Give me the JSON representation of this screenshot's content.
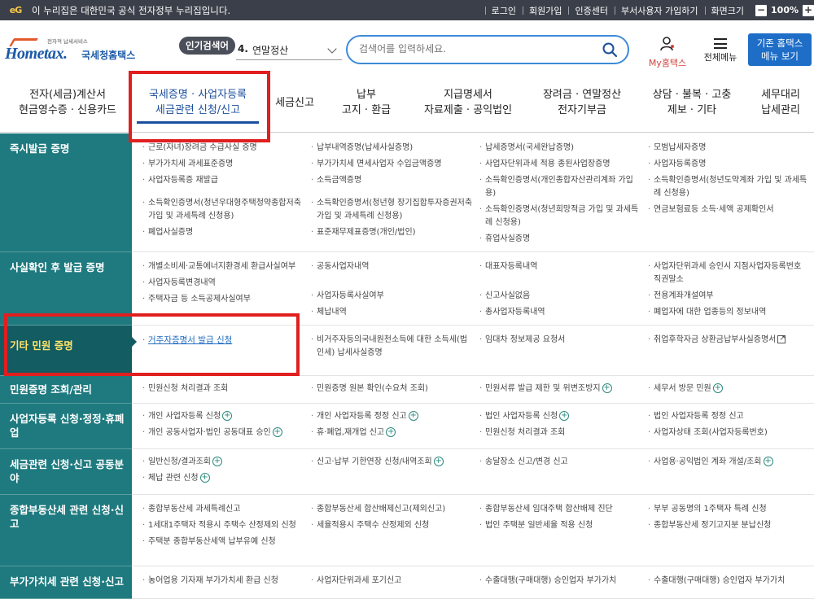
{
  "gov_bar": {
    "logo": "eG",
    "notice": "이 누리집은 대한민국 공식 전자정부 누리집입니다.",
    "links": [
      "로그인",
      "회원가입",
      "인증센터",
      "부서사용자 가입하기",
      "화면크기"
    ],
    "zoom_minus": "−",
    "zoom_value": "100%",
    "zoom_plus": "+"
  },
  "header": {
    "logo_top": "전자적 납세서비스",
    "logo_main": "Hometax.",
    "logo_sub": "국세청홈택스",
    "popular_badge": "인기검색어",
    "popular_rank": "4.",
    "popular_term": "연말정산",
    "search_placeholder": "검색어를 입력하세요.",
    "my_label": "My홈택스",
    "menu_label": "전체메뉴",
    "old_btn_line1": "기존 홈택스",
    "old_btn_line2": "메뉴 보기"
  },
  "nav": [
    {
      "l1": "전자(세금)계산서",
      "l2": "현금영수증 · 신용카드"
    },
    {
      "l1": "국세증명 · 사업자등록",
      "l2": "세금관련 신청/신고"
    },
    {
      "l1": "세금신고",
      "l2": ""
    },
    {
      "l1": "납부",
      "l2": "고지 · 환급"
    },
    {
      "l1": "지급명세서",
      "l2": "자료제출 · 공익법인"
    },
    {
      "l1": "장려금 · 연말정산",
      "l2": "전자기부금"
    },
    {
      "l1": "상담 · 불복 · 고충",
      "l2": "제보 · 기타"
    },
    {
      "l1": "세무대리",
      "l2": "납세관리"
    }
  ],
  "rows": [
    {
      "title": "즉시발급 증명",
      "cols": [
        [
          "근로(자녀)장려금 수급사실 증명",
          "부가가치세 과세표준증명",
          "사업자등록증 재발급",
          "소득확인증명서(청년우대형주택청약종합저축 가입 및 과세특례 신청용)",
          "폐업사실증명"
        ],
        [
          "납부내역증명(납세사실증명)",
          "부가가치세 면세사업자 수입금액증명",
          "소득금액증명",
          "소득확인증명서(청년형 장기집합투자증권저축 가입 및 과세특례 신청용)",
          "표준재무제표증명(개인/법인)"
        ],
        [
          "납세증명서(국세완납증명)",
          "사업자단위과세 적용 종된사업장증명",
          "소득확인증명서(개인종합자산관리계좌 가입용)",
          "소득확인증명서(청년희망적금 가입 및 과세특례 신청용)",
          "휴업사실증명"
        ],
        [
          "모범납세자증명",
          "사업자등록증명",
          "소득확인증명서(청년도약계좌 가입 및 과세특례 신청용)",
          "연금보험료등 소득·세액 공제확인서"
        ]
      ]
    },
    {
      "title": "사실확인 후 발급 증명",
      "cols": [
        [
          "개별소비세·교통에너지환경세 환급사실여부",
          "사업자등록변경내역",
          "주택자금 등 소득공제사실여부"
        ],
        [
          "공동사업자내역",
          "사업자등록사실여부",
          "체납내역"
        ],
        [
          "대표자등록내역",
          "신고사실없음",
          "총사업자등록내역"
        ],
        [
          "사업자단위과세 승인시 지점사업자등록번호 직권말소",
          "전용계좌개설여부",
          "폐업자에 대한 업종등의 정보내역"
        ]
      ]
    },
    {
      "title": "기타 민원 증명",
      "cols": [
        [
          "거주자증명서 발급 신청"
        ],
        [
          "비거주자등의국내원천소득에 대한 소득세(법인세) 납세사실증명"
        ],
        [
          "임대차 정보제공 요청서"
        ],
        [
          "취업후학자금 상환금납부사실증명서"
        ]
      ]
    },
    {
      "title": "민원증명 조회/관리",
      "cols": [
        [
          "민원신청 처리결과 조회"
        ],
        [
          "민원증명 원본 확인(수요처 조회)"
        ],
        [
          "민원서류 발급 제한 및 위변조방지"
        ],
        [
          "세무서 방문 민원"
        ]
      ]
    },
    {
      "title": "사업자등록 신청·정정·휴폐업",
      "cols": [
        [
          "개인 사업자등록 신청",
          "개인 공동사업자·법인 공동대표 승인"
        ],
        [
          "개인 사업자등록 정정 신고",
          "휴·폐업,재개업 신고"
        ],
        [
          "법인 사업자등록 신청",
          "민원신청 처리결과 조회"
        ],
        [
          "법인 사업자등록 정정 신고",
          "사업자상태 조회(사업자등록번호)"
        ]
      ]
    },
    {
      "title": "세금관련 신청·신고 공동분야",
      "cols": [
        [
          "일반신청/결과조회",
          "체납 관련 신청"
        ],
        [
          "신고·납부 기한연장 신청/내역조회"
        ],
        [
          "송달장소 신고/변경 신고"
        ],
        [
          "사업용·공익법인 계좌 개설/조회"
        ]
      ]
    },
    {
      "title": "종합부동산세 관련 신청·신고",
      "cols": [
        [
          "종합부동산세 과세특례신고",
          "1세대1주택자 적용시 주택수 산정제외 신청",
          "주택분 종합부동산세액 납부유예 신청"
        ],
        [
          "종합부동산세 합산배제신고(제외신고)",
          "세율적용시 주택수 산정제외 신청"
        ],
        [
          "종합부동산세 임대주택 합산배제 진단",
          "법인 주택분 일반세율 적용 신청"
        ],
        [
          "부부 공동명의 1주택자 특례 신청",
          "종합부동산세 정기고지분 분납신청"
        ]
      ]
    },
    {
      "title": "부가가치세 관련 신청·신고",
      "cols": [
        [
          "농어업용 기자재 부가가치세 환급 신청"
        ],
        [
          "사업자단위과세 포기신고"
        ],
        [
          "수출대행(구매대행) 승인업자 부가가치"
        ],
        [
          "수출대행(구매대행) 승인업자 부가가치"
        ]
      ]
    }
  ]
}
